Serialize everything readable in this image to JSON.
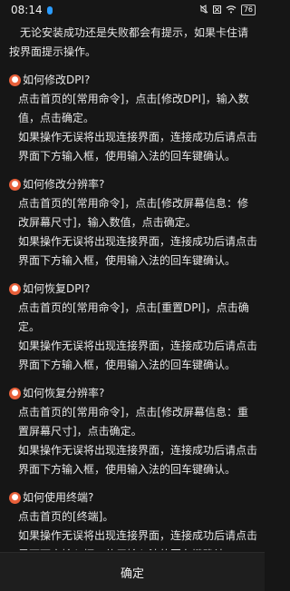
{
  "status_bar": {
    "time": "08:14",
    "battery": "76",
    "icons": [
      "mute-icon",
      "close-small-icon",
      "wifi-icon",
      "battery-icon"
    ]
  },
  "intro": "无论安装成功还是失败都会有提示，如果卡住请按界面提示操作。",
  "sections": [
    {
      "title": "如何修改DPI?",
      "lines": [
        "点击首页的[常用命令]，点击[修改DPI]，输入数值，点击确定。",
        "如果操作无误将出现连接界面，连接成功后请点击界面下方输入框，使用输入法的回车键确认。"
      ]
    },
    {
      "title": "如何修改分辨率?",
      "lines": [
        "点击首页的[常用命令]，点击[修改屏幕信息：修改屏幕尺寸]，输入数值，点击确定。",
        "如果操作无误将出现连接界面，连接成功后请点击界面下方输入框，使用输入法的回车键确认。"
      ]
    },
    {
      "title": "如何恢复DPI?",
      "lines": [
        "点击首页的[常用命令]，点击[重置DPI]，点击确定。",
        "如果操作无误将出现连接界面，连接成功后请点击界面下方输入框，使用输入法的回车键确认。"
      ]
    },
    {
      "title": "如何恢复分辨率?",
      "lines": [
        "点击首页的[常用命令]，点击[修改屏幕信息：重置屏幕尺寸]，点击确定。",
        "如果操作无误将出现连接界面，连接成功后请点击界面下方输入框，使用输入法的回车键确认。"
      ]
    },
    {
      "title": "如何使用终端?",
      "lines": [
        "点击首页的[终端]。",
        "如果操作无误将出现连接界面，连接成功后请点击界面下方输入框，使用输入法的回车键确认。"
      ]
    }
  ],
  "confirm_button": "确定",
  "colors": {
    "background": "#161616",
    "text": "#e6e6e6",
    "accent_icon": "#e8603a"
  }
}
